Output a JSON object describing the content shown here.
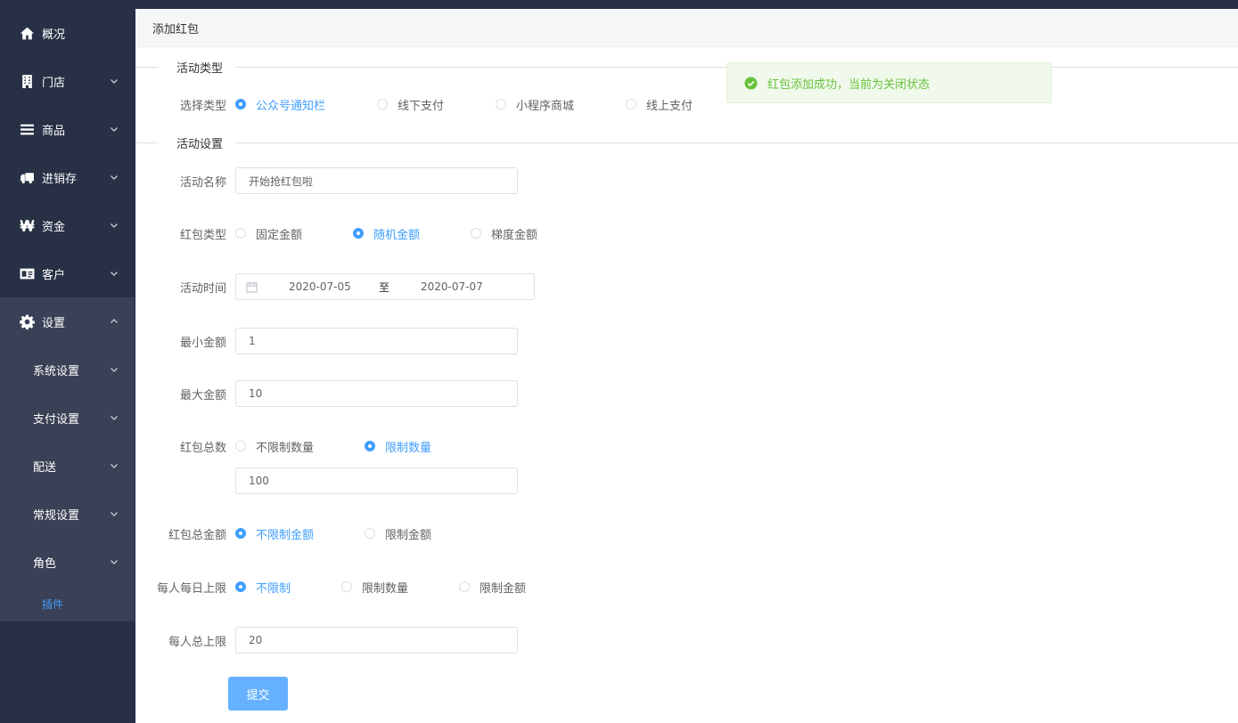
{
  "sidebar": {
    "items": [
      {
        "label": "概况",
        "icon": "home-icon",
        "has_chevron": false
      },
      {
        "label": "门店",
        "icon": "building-icon",
        "has_chevron": true
      },
      {
        "label": "商品",
        "icon": "list-icon",
        "has_chevron": true
      },
      {
        "label": "进销存",
        "icon": "truck-icon",
        "has_chevron": true
      },
      {
        "label": "资金",
        "icon": "won-icon",
        "has_chevron": true
      },
      {
        "label": "客户",
        "icon": "id-card-icon",
        "has_chevron": true
      },
      {
        "label": "设置",
        "icon": "gear-icon",
        "has_chevron": true,
        "expanded": true
      }
    ],
    "settings_children": [
      "系统设置",
      "支付设置",
      "配送",
      "常规设置",
      "角色"
    ],
    "leaf": "插件"
  },
  "page": {
    "title": "添加红包"
  },
  "sections": {
    "type": "活动类型",
    "settings": "活动设置"
  },
  "form": {
    "select_type": {
      "label": "选择类型",
      "options": [
        "公众号通知栏",
        "线下支付",
        "小程序商城",
        "线上支付"
      ],
      "selected": 0
    },
    "name": {
      "label": "活动名称",
      "value": "开始抢红包啦"
    },
    "hb_type": {
      "label": "红包类型",
      "options": [
        "固定金额",
        "随机金额",
        "梯度金额"
      ],
      "selected": 1
    },
    "time": {
      "label": "活动时间",
      "start": "2020-07-05",
      "separator": "至",
      "end": "2020-07-07"
    },
    "min": {
      "label": "最小金额",
      "value": "1"
    },
    "max": {
      "label": "最大金额",
      "value": "10"
    },
    "total_count": {
      "label": "红包总数",
      "options": [
        "不限制数量",
        "限制数量"
      ],
      "selected": 1,
      "value": "100"
    },
    "total_amount": {
      "label": "红包总金额",
      "options": [
        "不限制金额",
        "限制金额"
      ],
      "selected": 0
    },
    "daily_limit": {
      "label": "每人每日上限",
      "options": [
        "不限制",
        "限制数量",
        "限制金额"
      ],
      "selected": 0
    },
    "person_limit": {
      "label": "每人总上限",
      "value": "20"
    },
    "submit": "提交"
  },
  "toast": {
    "message": "红包添加成功，当前为关闭状态",
    "type": "success"
  },
  "colors": {
    "sidebar": "#283046",
    "accent": "#409eff",
    "success": "#67c23a"
  }
}
